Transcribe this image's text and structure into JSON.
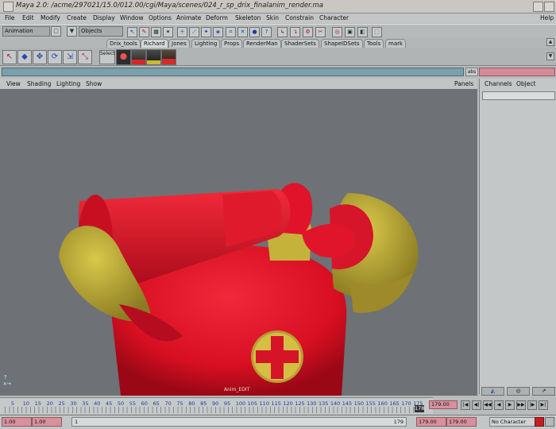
{
  "window": {
    "title": "Maya 2.0: /acme/297021/15.0/012.00/cgi/Maya/scenes/024_r_sp_drix_finalanim_render.ma"
  },
  "menubar": {
    "items": [
      "File",
      "Edit",
      "Modify",
      "Create",
      "Display",
      "Window",
      "Options",
      "Animate",
      "Deform",
      "Skeleton",
      "Skin",
      "Constrain",
      "Character"
    ],
    "help": "Help"
  },
  "statusline": {
    "menu_set": "Animation",
    "selection_mode": "Objects"
  },
  "shelf": {
    "tabs": [
      "Drix_tools",
      "Richard",
      "Jones",
      "Lighting",
      "Props",
      "RenderMan",
      "ShaderSets",
      "ShapeIDSets",
      "Tools",
      "mark"
    ],
    "active_tab": "Richard",
    "select_label": "Select"
  },
  "panel": {
    "menu": [
      "View",
      "Shading",
      "Lighting",
      "Show"
    ],
    "panels_label": "Panels",
    "camera_label": "Anim_EDIT"
  },
  "channel_box": {
    "tabs": [
      "Channels",
      "Object"
    ]
  },
  "timeline": {
    "ticks": [
      5,
      10,
      15,
      20,
      25,
      30,
      35,
      40,
      45,
      50,
      55,
      60,
      65,
      70,
      75,
      80,
      85,
      90,
      95,
      100,
      105,
      110,
      115,
      120,
      125,
      130,
      135,
      140,
      145,
      150,
      155,
      160,
      165,
      170,
      175
    ],
    "current_frame": "178",
    "current_time_field": "179.00"
  },
  "range": {
    "start_time": "1.00",
    "playback_start": "1.00",
    "range_start_label": "1",
    "range_end_label": "179",
    "playback_end": "179.00",
    "end_time": "179.00",
    "character": "No Character"
  },
  "colors": {
    "character_red": "#e01428",
    "character_gold": "#c6b338",
    "viewport_bg": "#6b6e72",
    "command_line": "#7aa1ab",
    "time_fields": "#d8909c"
  }
}
